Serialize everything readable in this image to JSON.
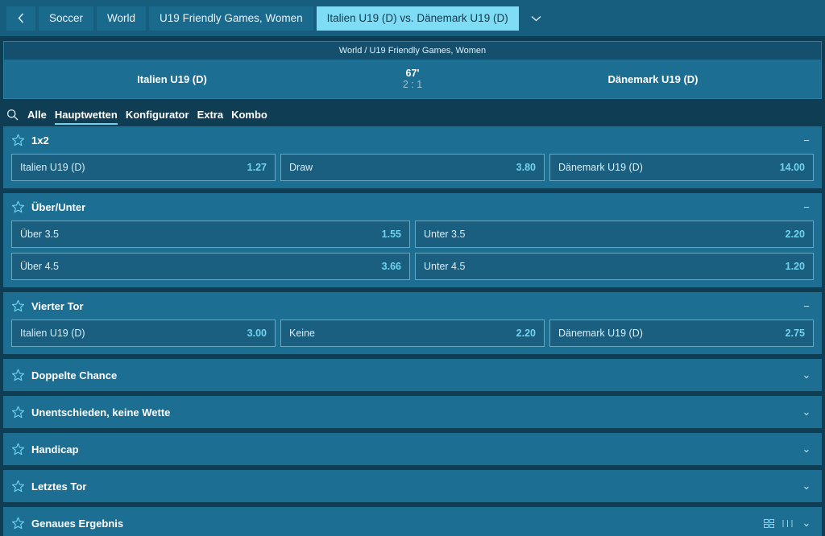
{
  "breadcrumb": {
    "back_icon": "chevron-left-icon",
    "items": [
      {
        "label": "Soccer",
        "active": false
      },
      {
        "label": "World",
        "active": false
      },
      {
        "label": "U19 Friendly Games, Women",
        "active": false
      },
      {
        "label": "Italien U19 (D) vs. Dänemark U19 (D)",
        "active": true
      }
    ],
    "dropdown_icon": "chevron-down-icon"
  },
  "match": {
    "league": "World / U19 Friendly Games, Women",
    "home_team": "Italien U19 (D)",
    "away_team": "Dänemark U19 (D)",
    "minute": "67'",
    "score": "2 : 1"
  },
  "tabs": {
    "search_icon": "search-icon",
    "items": [
      {
        "label": "Alle",
        "active": false
      },
      {
        "label": "Hauptwetten",
        "active": true
      },
      {
        "label": "Konfigurator",
        "active": false
      },
      {
        "label": "Extra",
        "active": false
      },
      {
        "label": "Kombo",
        "active": false
      }
    ]
  },
  "markets": [
    {
      "title": "1x2",
      "expanded": true,
      "toggle": "−",
      "rows": [
        [
          {
            "label": "Italien U19 (D)",
            "odds": "1.27"
          },
          {
            "label": "Draw",
            "odds": "3.80"
          },
          {
            "label": "Dänemark U19 (D)",
            "odds": "14.00"
          }
        ]
      ]
    },
    {
      "title": "Über/Unter",
      "expanded": true,
      "toggle": "−",
      "rows": [
        [
          {
            "label": "Über 3.5",
            "odds": "1.55"
          },
          {
            "label": "Unter 3.5",
            "odds": "2.20"
          }
        ],
        [
          {
            "label": "Über 4.5",
            "odds": "3.66"
          },
          {
            "label": "Unter 4.5",
            "odds": "1.20"
          }
        ]
      ]
    },
    {
      "title": "Vierter Tor",
      "expanded": true,
      "toggle": "−",
      "rows": [
        [
          {
            "label": "Italien U19 (D)",
            "odds": "3.00"
          },
          {
            "label": "Keine",
            "odds": "2.20"
          },
          {
            "label": "Dänemark U19 (D)",
            "odds": "2.75"
          }
        ]
      ]
    },
    {
      "title": "Doppelte Chance",
      "expanded": false,
      "toggle": "⌄",
      "rows": []
    },
    {
      "title": "Unentschieden, keine Wette",
      "expanded": false,
      "toggle": "⌄",
      "rows": []
    },
    {
      "title": "Handicap",
      "expanded": false,
      "toggle": "⌄",
      "rows": []
    },
    {
      "title": "Letztes Tor",
      "expanded": false,
      "toggle": "⌄",
      "rows": []
    },
    {
      "title": "Genaues Ergebnis",
      "expanded": false,
      "toggle": "⌄",
      "rows": [],
      "extra_icons": [
        "grid-view-icon",
        "list-view-icon"
      ]
    }
  ],
  "colors": {
    "page_background": "#0f3d54",
    "panel": "#1d6e93",
    "header_bar": "#175d7e",
    "accent": "#6fd4ef",
    "active_chip": "#7fdcf5",
    "odds_button": "#1a5f80"
  }
}
